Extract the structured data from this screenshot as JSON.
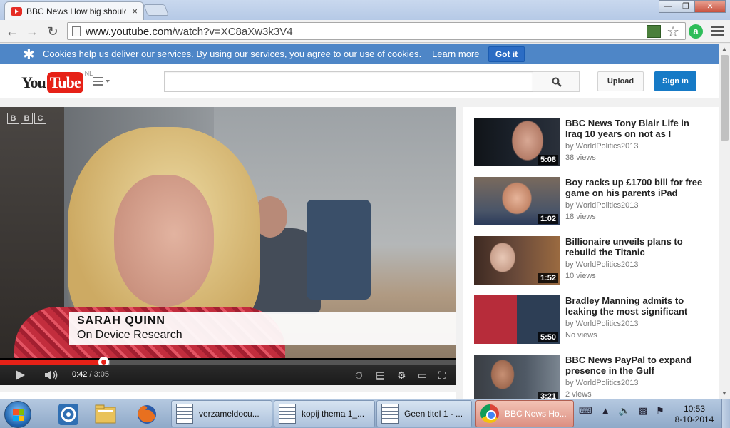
{
  "browser": {
    "tab_title": "BBC News How big shoulc",
    "tab_close": "×",
    "url_prefix": "www.youtube.com",
    "url_path": "/watch?v=XC8aXw3k3V4",
    "window_buttons": {
      "minimize": "—",
      "maximize": "❐",
      "close": "✕"
    }
  },
  "cookie_bar": {
    "message": "Cookies help us deliver our services. By using our services, you agree to our use of cookies.",
    "learn_more": "Learn more",
    "got_it": "Got it"
  },
  "masthead": {
    "logo_you": "You",
    "logo_tube": "Tube",
    "region": "NL",
    "search_placeholder": "",
    "upload": "Upload",
    "sign_in": "Sign in"
  },
  "player": {
    "watermark": [
      "B",
      "B",
      "C"
    ],
    "lower_third_name": "SARAH QUINN",
    "lower_third_role": "On Device Research",
    "current_time": "0:42",
    "separator": " / ",
    "duration": "3:05",
    "played_fraction": 0.227,
    "loaded_fraction": 0.24
  },
  "related": [
    {
      "title": "BBC News Tony Blair Life in Iraq 10 years on not as I",
      "by": "by WorldPolitics2013",
      "views": "38 views",
      "duration": "5:08"
    },
    {
      "title": "Boy racks up £1700 bill for free game on his parents iPad",
      "by": "by WorldPolitics2013",
      "views": "18 views",
      "duration": "1:02"
    },
    {
      "title": "Billionaire unveils plans to rebuild the Titanic",
      "by": "by WorldPolitics2013",
      "views": "10 views",
      "duration": "1:52"
    },
    {
      "title": "Bradley Manning admits to leaking the most significant",
      "by": "by WorldPolitics2013",
      "views": "No views",
      "duration": "5:50"
    },
    {
      "title": "BBC News PayPal to expand presence in the Gulf",
      "by": "by WorldPolitics2013",
      "views": "2 views",
      "duration": "3:21"
    }
  ],
  "taskbar": {
    "tasks": [
      "verzameldocu...",
      "kopij thema 1_...",
      "Geen titel 1 - ...",
      "BBC News Ho..."
    ],
    "time": "10:53",
    "date": "8-10-2014"
  },
  "colors": {
    "youtube_red": "#e62117",
    "cookie_bar": "#4e86c7",
    "signin_blue": "#167ac6"
  }
}
